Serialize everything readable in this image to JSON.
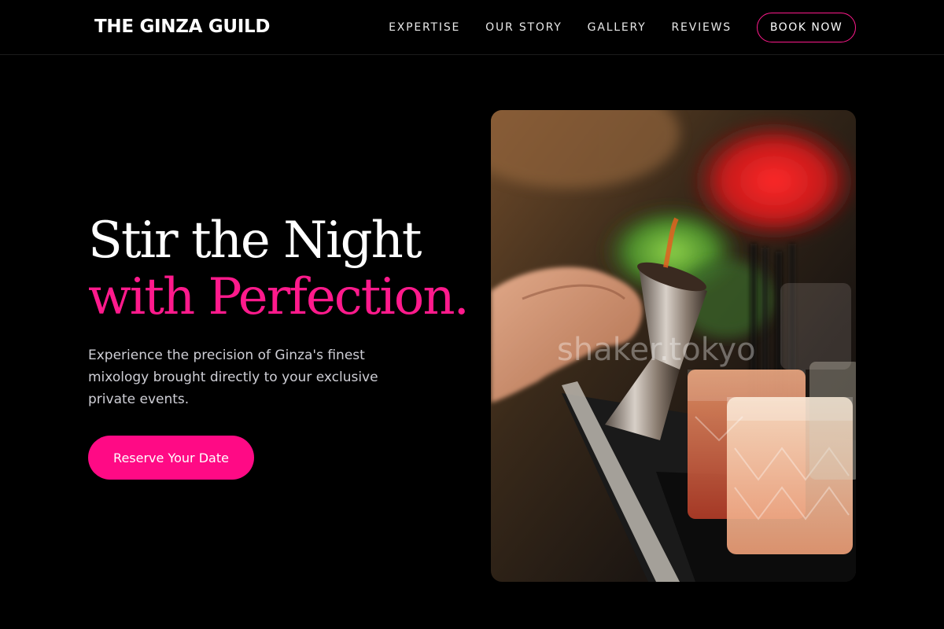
{
  "header": {
    "logo": "THE GINZA GUILD",
    "nav": [
      "EXPERTISE",
      "OUR STORY",
      "GALLERY",
      "REVIEWS"
    ],
    "book_label": "BOOK NOW"
  },
  "hero": {
    "title_line1": "Stir the Night",
    "title_line2": "with Perfection.",
    "description": "Experience the precision of Ginza's finest mixology brought directly to your exclusive private events.",
    "cta_label": "Reserve Your Date"
  },
  "photo": {
    "watermark": "shaker.tokyo"
  },
  "colors": {
    "accent": "#ff0a85",
    "background": "#000000"
  }
}
